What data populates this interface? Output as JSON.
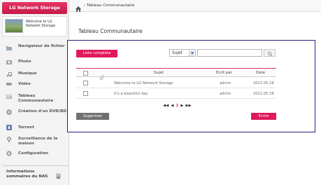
{
  "sidebar": {
    "brand": "LG Network Storage",
    "welcome_text": "Welcome to LG Network Storage",
    "items": [
      {
        "label": "Navigateur de fichier",
        "icon": "folder-icon"
      },
      {
        "label": "Photo",
        "icon": "photo-icon"
      },
      {
        "label": "Musique",
        "icon": "music-icon"
      },
      {
        "label": "Vidéo",
        "icon": "video-icon"
      },
      {
        "label": "Tableau Communautaire",
        "icon": "board-icon"
      },
      {
        "label": "Création d'un DVD/BD",
        "icon": "disc-icon"
      },
      {
        "label": "Torrent",
        "icon": "torrent-icon"
      },
      {
        "label": "Surveillance de la maison",
        "icon": "camera-icon"
      },
      {
        "label": "Configuration",
        "icon": "gear-icon"
      }
    ],
    "info_label": "Informations sommaires du NAS"
  },
  "breadcrumb": "Tableau Communautaire",
  "page_title": "Tableau Communautaire",
  "toolbar": {
    "list_button": "Liste complète",
    "select_value": "Sujet",
    "search_placeholder": ""
  },
  "table": {
    "columns": {
      "subject": "Sujet",
      "author": "Ecrit par",
      "date": "Date"
    },
    "rows": [
      {
        "subject": "Welcome to LG Network Storage",
        "author": "admin",
        "date": "2011.05.19"
      },
      {
        "subject": "It's a beautiful day",
        "author": "admin",
        "date": "2011.05.19"
      }
    ]
  },
  "pagination": {
    "first": "◀◀",
    "prev": "◀",
    "current": "1",
    "next": "▶",
    "last": "▶▶"
  },
  "actions": {
    "delete": "Supprimer",
    "write": "Ecrire"
  },
  "colors": {
    "accent": "#e0195a",
    "border": "#23237a"
  }
}
